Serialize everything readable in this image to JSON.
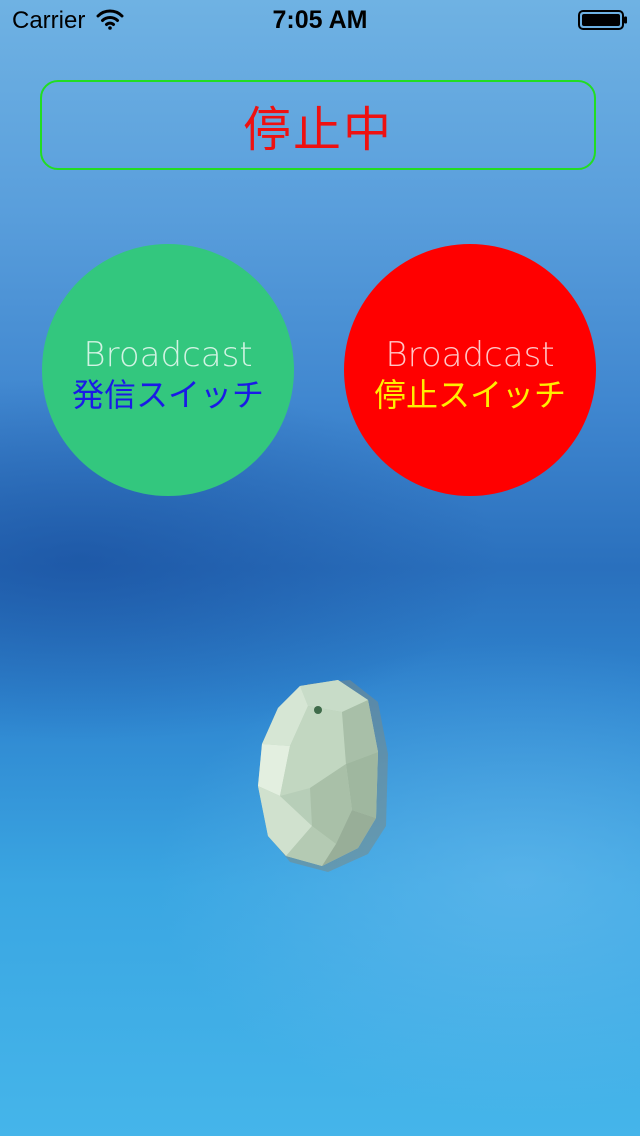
{
  "status_bar": {
    "carrier": "Carrier",
    "time": "7:05 AM"
  },
  "status_panel": {
    "text": "停止中",
    "text_color": "#ee1111",
    "border_color": "#22dd22"
  },
  "buttons": {
    "start": {
      "line1": "Broadcast",
      "line2": "発信スイッチ",
      "bg_color": "#33c77e",
      "text_color": "#1a1ae6"
    },
    "stop": {
      "line1": "Broadcast",
      "line2": "停止スイッチ",
      "bg_color": "#ff0000",
      "text_color": "#ffee00"
    }
  },
  "icons": {
    "wifi": "wifi-icon",
    "battery": "battery-icon",
    "beacon": "beacon-image"
  }
}
